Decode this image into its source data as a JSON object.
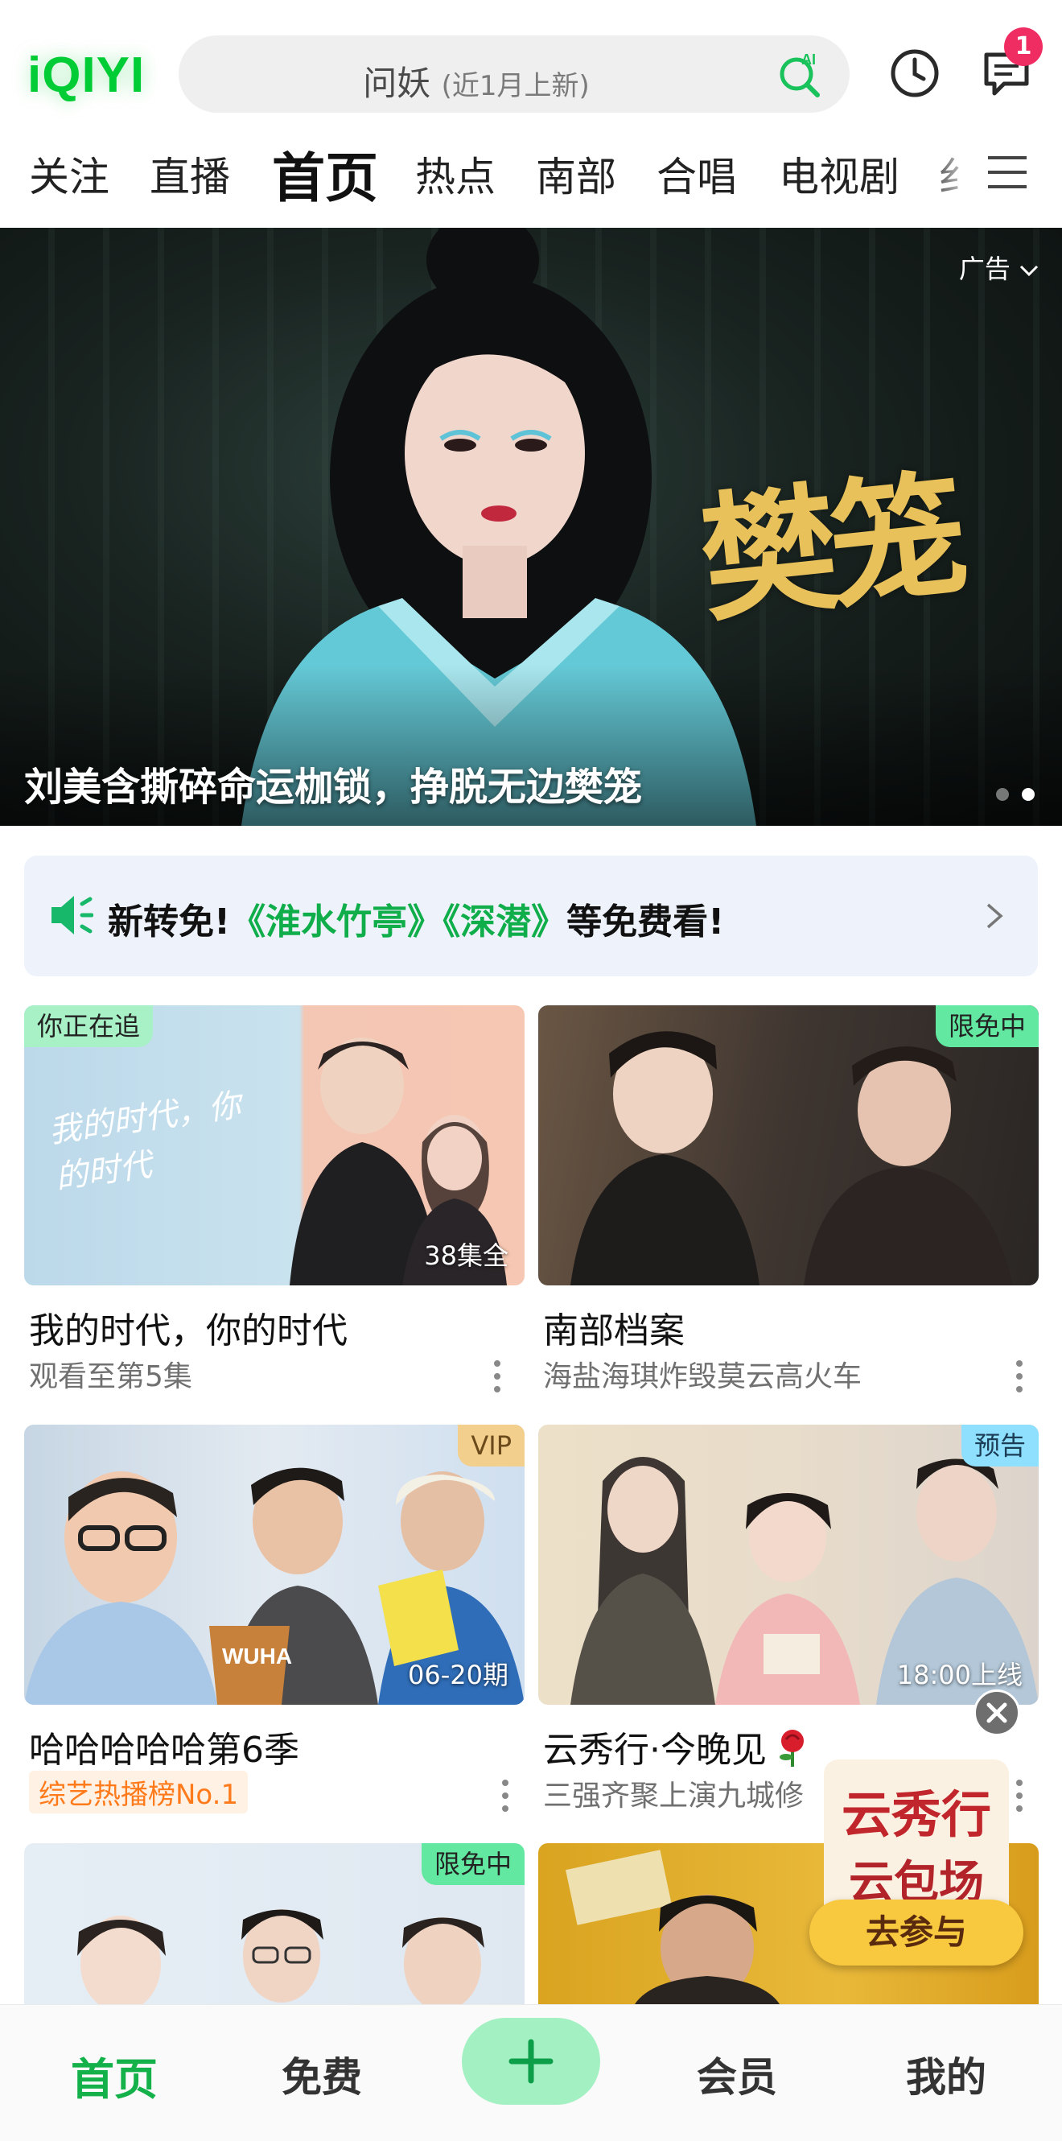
{
  "header": {
    "logo": "iQIYI",
    "search": {
      "keyword": "问妖",
      "hint": "(近1月上新)"
    },
    "message_badge": "1"
  },
  "tabs": [
    {
      "label": "关注"
    },
    {
      "label": "直播"
    },
    {
      "label": "首页",
      "active": true
    },
    {
      "label": "热点"
    },
    {
      "label": "南部"
    },
    {
      "label": "合唱"
    },
    {
      "label": "电视剧"
    },
    {
      "label": "纟"
    }
  ],
  "banner": {
    "ad_label": "广告",
    "title_art": "樊笼",
    "caption": "刘美含撕碎命运枷锁，挣脱无边樊笼",
    "page_count": 2,
    "active_page": 2
  },
  "notice": {
    "prefix": "新转免!",
    "highlight": "《淮水竹亭》《深潜》",
    "suffix": "等免费看!"
  },
  "cards": [
    {
      "title": "我的时代，你的时代",
      "subtitle": "观看至第5集",
      "tag": "你正在追",
      "tag_side": "left",
      "tag_style": "follow",
      "episode": "38集全",
      "thumb_text": "我的时代，你的时代"
    },
    {
      "title": "南部档案",
      "subtitle": "海盐海琪炸毁莫云高火车",
      "tag": "限免中",
      "tag_side": "right",
      "tag_style": "free",
      "episode": ""
    },
    {
      "title": "哈哈哈哈哈第6季",
      "subtitle": "综艺热播榜No.1",
      "subtitle_style": "rank",
      "tag": "VIP",
      "tag_side": "right",
      "tag_style": "vip",
      "episode": "06-20期",
      "thumb_text": "WUHA"
    },
    {
      "title": "云秀行·今晚见",
      "subtitle": "三强齐聚上演九城修",
      "tag": "预告",
      "tag_side": "right",
      "tag_style": "preview",
      "episode": "18:00上线"
    },
    {
      "title": "",
      "subtitle": "",
      "tag": "限免中",
      "tag_side": "right",
      "tag_style": "free",
      "episode": ""
    },
    {
      "title": "",
      "subtitle": "",
      "tag": "",
      "episode": ""
    }
  ],
  "promo": {
    "title_line1": "云秀行",
    "title_line2": "云包场",
    "button": "去参与"
  },
  "bottom_nav": [
    {
      "label": "首页",
      "active": true
    },
    {
      "label": "免费"
    },
    {
      "label": "会员"
    },
    {
      "label": "我的"
    }
  ],
  "colors": {
    "brand_green": "#00cc36",
    "accent_green": "#14b14a",
    "badge_red": "#f02d62",
    "notice_highlight": "#0fae4a"
  },
  "icons": {
    "search_right": "ai-search-icon",
    "history": "clock-icon",
    "messages": "message-icon",
    "menu": "menu-icon",
    "notice": "speaker-icon",
    "notice_arrow": "chevron-right-icon",
    "card_more": "more-vertical-icon",
    "nav_center": "plus-icon",
    "promo_close": "close-icon"
  }
}
